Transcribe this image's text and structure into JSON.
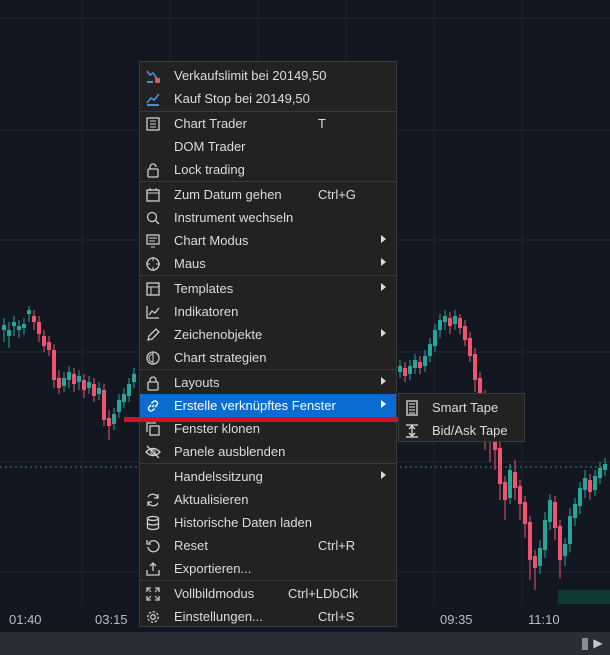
{
  "time_axis": [
    "01:40",
    "03:15",
    "09:35",
    "11:10"
  ],
  "context_menu": {
    "items": [
      {
        "label": "Verkaufslimit bei 20149,50",
        "shortcut": "",
        "icon": "sell-limit-icon",
        "submenu": false
      },
      {
        "label": "Kauf Stop bei 20149,50",
        "shortcut": "",
        "icon": "buy-stop-icon",
        "submenu": false
      },
      {
        "label": "Chart Trader",
        "shortcut": "T",
        "icon": "chart-trader-icon",
        "submenu": false
      },
      {
        "label": "DOM Trader",
        "shortcut": "",
        "icon": "",
        "submenu": false
      },
      {
        "label": "Lock trading",
        "shortcut": "",
        "icon": "lock-icon",
        "submenu": false
      },
      {
        "label": "Zum Datum gehen",
        "shortcut": "Ctrl+G",
        "icon": "calendar-icon",
        "submenu": false
      },
      {
        "label": "Instrument wechseln",
        "shortcut": "",
        "icon": "search-icon",
        "submenu": false
      },
      {
        "label": "Chart Modus",
        "shortcut": "",
        "icon": "chart-mode-icon",
        "submenu": true
      },
      {
        "label": "Maus",
        "shortcut": "",
        "icon": "crosshair-icon",
        "submenu": true
      },
      {
        "label": "Templates",
        "shortcut": "",
        "icon": "templates-icon",
        "submenu": true
      },
      {
        "label": "Indikatoren",
        "shortcut": "",
        "icon": "indicators-icon",
        "submenu": false
      },
      {
        "label": "Zeichenobjekte",
        "shortcut": "",
        "icon": "pencil-icon",
        "submenu": true
      },
      {
        "label": "Chart strategien",
        "shortcut": "",
        "icon": "strategy-icon",
        "submenu": false
      },
      {
        "label": "Layouts",
        "shortcut": "",
        "icon": "layouts-lock-icon",
        "submenu": true
      },
      {
        "label": "Erstelle verknüpftes Fenster",
        "shortcut": "",
        "icon": "link-icon",
        "submenu": true,
        "active": true
      },
      {
        "label": "Fenster klonen",
        "shortcut": "",
        "icon": "clone-icon",
        "submenu": false
      },
      {
        "label": "Panele ausblenden",
        "shortcut": "",
        "icon": "eye-off-icon",
        "submenu": false
      },
      {
        "label": "Handelssitzung",
        "shortcut": "",
        "icon": "",
        "submenu": true
      },
      {
        "label": "Aktualisieren",
        "shortcut": "",
        "icon": "refresh-icon",
        "submenu": false
      },
      {
        "label": "Historische Daten laden",
        "shortcut": "",
        "icon": "database-icon",
        "submenu": false
      },
      {
        "label": "Reset",
        "shortcut": "Ctrl+R",
        "icon": "reset-icon",
        "submenu": false
      },
      {
        "label": "Exportieren...",
        "shortcut": "",
        "icon": "export-icon",
        "submenu": false
      },
      {
        "label": "Vollbildmodus",
        "shortcut": "Ctrl+LDbClk",
        "icon": "fullscreen-icon",
        "submenu": false
      },
      {
        "label": "Einstellungen...",
        "shortcut": "Ctrl+S",
        "icon": "settings-icon",
        "submenu": false
      }
    ]
  },
  "submenu": {
    "items": [
      {
        "label": "Smart Tape",
        "icon": "smart-tape-icon"
      },
      {
        "label": "Bid/Ask Tape",
        "icon": "bid-ask-tape-icon"
      }
    ]
  },
  "colors": {
    "background": "#131722",
    "menu_bg": "#222222",
    "highlight": "#0a6cd0",
    "candle_up": "#26a69a",
    "candle_down": "#ef5370",
    "annotation_line": "#d1121f"
  }
}
